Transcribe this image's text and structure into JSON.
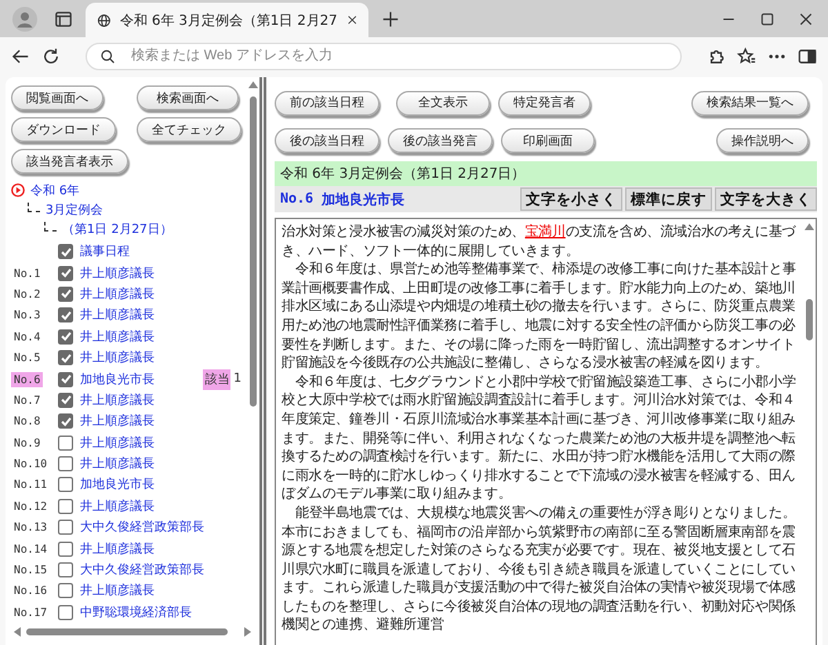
{
  "browser": {
    "tab_title": "令和 6年 3月定例会（第1日 2月27",
    "address_placeholder": "検索または Web アドレスを入力"
  },
  "sidebar": {
    "buttons": [
      {
        "label": "閲覧画面へ"
      },
      {
        "label": "検索画面へ"
      },
      {
        "label": "ダウンロード"
      },
      {
        "label": "全てチェック"
      },
      {
        "label": "該当発言者表示"
      }
    ],
    "tree": {
      "label": "令和 6年",
      "children": [
        {
          "label": "3月定例会",
          "children": [
            {
              "label": "（第1日 2月27日）"
            }
          ]
        }
      ]
    },
    "items": [
      {
        "checked": true,
        "name": "議事日程",
        "selected": false
      },
      {
        "number": "No.1",
        "checked": true,
        "name": "井上順彦議長",
        "selected": false
      },
      {
        "number": "No.2",
        "checked": true,
        "name": "井上順彦議長",
        "selected": false
      },
      {
        "number": "No.3",
        "checked": true,
        "name": "井上順彦議長",
        "selected": false
      },
      {
        "number": "No.4",
        "checked": true,
        "name": "井上順彦議長",
        "selected": false
      },
      {
        "number": "No.5",
        "checked": true,
        "name": "井上順彦議長",
        "selected": false
      },
      {
        "number": "No.6",
        "checked": true,
        "name": "加地良光市長",
        "selected": true,
        "hit_label": "該当",
        "hit_count": "1"
      },
      {
        "number": "No.7",
        "checked": true,
        "name": "井上順彦議長",
        "selected": false
      },
      {
        "number": "No.8",
        "checked": true,
        "name": "井上順彦議長",
        "selected": false
      },
      {
        "number": "No.9",
        "checked": false,
        "name": "井上順彦議長",
        "selected": false
      },
      {
        "number": "No.10",
        "checked": false,
        "name": "井上順彦議長",
        "selected": false
      },
      {
        "number": "No.11",
        "checked": false,
        "name": "加地良光市長",
        "selected": false
      },
      {
        "number": "No.12",
        "checked": false,
        "name": "井上順彦議長",
        "selected": false
      },
      {
        "number": "No.13",
        "checked": false,
        "name": "大中久俊経営政策部長",
        "selected": false
      },
      {
        "number": "No.14",
        "checked": false,
        "name": "井上順彦議長",
        "selected": false
      },
      {
        "number": "No.15",
        "checked": false,
        "name": "大中久俊経営政策部長",
        "selected": false
      },
      {
        "number": "No.16",
        "checked": false,
        "name": "井上順彦議長",
        "selected": false
      },
      {
        "number": "No.17",
        "checked": false,
        "name": "中野聡環境経済部長",
        "selected": false
      }
    ]
  },
  "toolbar": {
    "row_1": [
      {
        "label": "前の該当日程"
      },
      {
        "label": "全文表示"
      },
      {
        "label": "特定発言者"
      },
      {
        "label": "検索結果一覧へ"
      }
    ],
    "row_2": [
      {
        "label": "後の該当日程"
      },
      {
        "label": "後の該当発言"
      },
      {
        "label": "印刷画面"
      },
      {
        "label": "操作説明へ"
      }
    ]
  },
  "meeting_title": "令和 6年 3月定例会（第1日 2月27日）",
  "speaker": {
    "number": "No.6",
    "name": "加地良光市長"
  },
  "font_buttons": [
    {
      "label": "文字を小さく"
    },
    {
      "label": "標準に戻す"
    },
    {
      "label": "文字を大きく"
    }
  ],
  "paragraphs": [
    {
      "indent": false,
      "parts": [
        {
          "text": "治水対策と浸水被害の減災対策のため、",
          "kind": "plain"
        },
        {
          "text": "宝満川",
          "kind": "term"
        },
        {
          "text": "の支流を含め、流域治水の考えに基づき、ハード、ソフト一体的に展開していきます。",
          "kind": "plain"
        }
      ]
    },
    {
      "indent": true,
      "parts": [
        {
          "text": "令和６年度は、県営ため池等整備事業で、柿添堤の改修工事に向けた基本設計と事業計画概要書作成、上田町堤の改修工事に着手します。貯水能力向上のため、築地川排水区域にある山添堤や内畑堤の堆積土砂の撤去を行います。さらに、防災重点農業用ため池の地震耐性評価業務に着手し、地震に対する安全性の評価から防災工事の必要性を判断します。また、その場に降った雨を一時貯留し、流出調整するオンサイト貯留施設を今後既存の公共施設に整備し、さらなる浸水被害の軽減を図ります。",
          "kind": "plain"
        }
      ]
    },
    {
      "indent": true,
      "parts": [
        {
          "text": "令和６年度は、七夕グラウンドと小郡中学校で貯留施設築造工事、さらに小郡小学校と大原中学校では雨水貯留施設調査設計に着手します。河川治水対策では、令和４年度策定、鐘巻川・石原川流域治水事業基本計画に基づき、河川改修事業に取り組みます。また、開発等に伴い、利用されなくなった農業ため池の大板井堤を調整池へ転換するための調査検討を行います。新たに、水田が持つ貯水機能を活用して大雨の際に雨水を一時的に貯水しゆっくり排水することで下流域の浸水被害を軽減する、田んぼダムのモデル事業に取り組みます。",
          "kind": "plain"
        }
      ]
    },
    {
      "indent": true,
      "parts": [
        {
          "text": "能登半島地震では、大規模な地震災害への備えの重要性が浮き彫りとなりました。本市におきましても、福岡市の沿岸部から筑紫野市の南部に至る警固断層東南部を震源とする地震を想定した対策のさらなる充実が必要です。現在、被災地支援として石川県穴水町に職員を派遣しており、今後も引き続き職員を派遣していくことにしています。これら派遣した職員が支援活動の中で得た被災自治体の実情や被災現場で体感したものを整理し、さらに今後被災自治体の現地の調査活動を行い、初動対応や関係機関との連携、避難所運営",
          "kind": "plain"
        }
      ]
    }
  ]
}
